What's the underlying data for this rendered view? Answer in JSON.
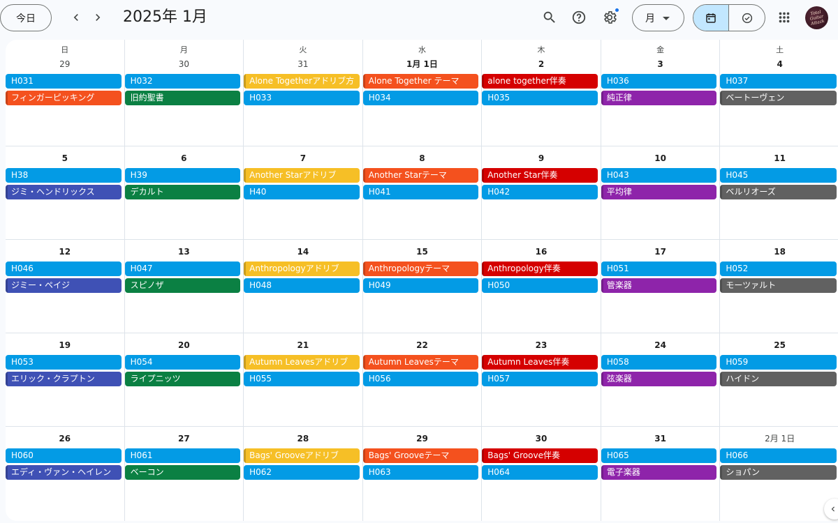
{
  "header": {
    "today_label": "今日",
    "month_title": "2025年 1月",
    "view_label": "月"
  },
  "icons": {
    "prev": "chevron-left-icon",
    "next": "chevron-right-icon",
    "search": "search-icon",
    "help": "help-icon",
    "settings": "gear-icon",
    "calendar_view": "calendar-icon",
    "tasks_view": "task-check-icon",
    "apps": "apps-grid-icon",
    "side_panel": "chevron-left-icon"
  },
  "avatar_text": "Total Guitar Attack",
  "colors": {
    "peacock": "#039be5",
    "tangerine": "#f4511e",
    "basil": "#0b8043",
    "banana": "#f6bf26",
    "tomato": "#d50000",
    "grape": "#8e24aa",
    "graphite": "#616161",
    "blueberry": "#3f51b5",
    "toggle_active": "#c2e7ff"
  },
  "weekdays": [
    "日",
    "月",
    "火",
    "水",
    "木",
    "金",
    "土"
  ],
  "weeks": [
    [
      {
        "day": "29",
        "other": true,
        "events": [
          {
            "title": "H031",
            "color": "peacock"
          },
          {
            "title": "フィンガーピッキング",
            "color": "tangerine",
            "bar": true
          }
        ]
      },
      {
        "day": "30",
        "other": true,
        "events": [
          {
            "title": "H032",
            "color": "peacock"
          },
          {
            "title": "旧約聖書",
            "color": "basil"
          }
        ]
      },
      {
        "day": "31",
        "other": true,
        "events": [
          {
            "title": "Alone Togetherアドリブ方",
            "color": "banana",
            "bar": true
          },
          {
            "title": "H033",
            "color": "peacock"
          }
        ]
      },
      {
        "day": "1月 1日",
        "events": [
          {
            "title": "Alone Together テーマ",
            "color": "tangerine",
            "bar": true
          },
          {
            "title": "H034",
            "color": "peacock"
          }
        ]
      },
      {
        "day": "2",
        "events": [
          {
            "title": "alone together伴奏",
            "color": "tomato",
            "bar": true
          },
          {
            "title": "H035",
            "color": "peacock"
          }
        ]
      },
      {
        "day": "3",
        "events": [
          {
            "title": "H036",
            "color": "peacock"
          },
          {
            "title": "純正律",
            "color": "grape",
            "bar": true
          }
        ]
      },
      {
        "day": "4",
        "events": [
          {
            "title": "H037",
            "color": "peacock"
          },
          {
            "title": "ベートーヴェン",
            "color": "graphite",
            "bar": true
          }
        ]
      }
    ],
    [
      {
        "day": "5",
        "events": [
          {
            "title": "H38",
            "color": "peacock"
          },
          {
            "title": "ジミ・ヘンドリックス",
            "color": "blueberry",
            "bar": true
          }
        ]
      },
      {
        "day": "6",
        "events": [
          {
            "title": "H39",
            "color": "peacock"
          },
          {
            "title": "デカルト",
            "color": "basil"
          }
        ]
      },
      {
        "day": "7",
        "events": [
          {
            "title": "Another Starアドリブ",
            "color": "banana",
            "bar": true
          },
          {
            "title": "H40",
            "color": "peacock"
          }
        ]
      },
      {
        "day": "8",
        "events": [
          {
            "title": "Another Starテーマ",
            "color": "tangerine",
            "bar": true
          },
          {
            "title": "H041",
            "color": "peacock"
          }
        ]
      },
      {
        "day": "9",
        "events": [
          {
            "title": "Another Star伴奏",
            "color": "tomato",
            "bar": true
          },
          {
            "title": "H042",
            "color": "peacock"
          }
        ]
      },
      {
        "day": "10",
        "events": [
          {
            "title": "H043",
            "color": "peacock"
          },
          {
            "title": "平均律",
            "color": "grape",
            "bar": true
          }
        ]
      },
      {
        "day": "11",
        "events": [
          {
            "title": "H045",
            "color": "peacock"
          },
          {
            "title": "ベルリオーズ",
            "color": "graphite",
            "bar": true
          }
        ]
      }
    ],
    [
      {
        "day": "12",
        "events": [
          {
            "title": "H046",
            "color": "peacock"
          },
          {
            "title": "ジミー・ペイジ",
            "color": "blueberry",
            "bar": true
          }
        ]
      },
      {
        "day": "13",
        "events": [
          {
            "title": "H047",
            "color": "peacock"
          },
          {
            "title": "スピノザ",
            "color": "basil"
          }
        ]
      },
      {
        "day": "14",
        "events": [
          {
            "title": "Anthropologyアドリブ",
            "color": "banana",
            "bar": true
          },
          {
            "title": "H048",
            "color": "peacock"
          }
        ]
      },
      {
        "day": "15",
        "events": [
          {
            "title": "Anthropologyテーマ",
            "color": "tangerine",
            "bar": true
          },
          {
            "title": "H049",
            "color": "peacock"
          }
        ]
      },
      {
        "day": "16",
        "events": [
          {
            "title": "Anthropology伴奏",
            "color": "tomato",
            "bar": true
          },
          {
            "title": "H050",
            "color": "peacock"
          }
        ]
      },
      {
        "day": "17",
        "events": [
          {
            "title": "H051",
            "color": "peacock"
          },
          {
            "title": "管楽器",
            "color": "grape",
            "bar": true
          }
        ]
      },
      {
        "day": "18",
        "events": [
          {
            "title": "H052",
            "color": "peacock"
          },
          {
            "title": "モーツァルト",
            "color": "graphite",
            "bar": true
          }
        ]
      }
    ],
    [
      {
        "day": "19",
        "events": [
          {
            "title": "H053",
            "color": "peacock"
          },
          {
            "title": "エリック・クラプトン",
            "color": "blueberry",
            "bar": true
          }
        ]
      },
      {
        "day": "20",
        "events": [
          {
            "title": "H054",
            "color": "peacock"
          },
          {
            "title": "ライプニッツ",
            "color": "basil"
          }
        ]
      },
      {
        "day": "21",
        "events": [
          {
            "title": "Autumn Leavesアドリブ",
            "color": "banana",
            "bar": true
          },
          {
            "title": "H055",
            "color": "peacock"
          }
        ]
      },
      {
        "day": "22",
        "events": [
          {
            "title": "Autumn Leavesテーマ",
            "color": "tangerine",
            "bar": true
          },
          {
            "title": "H056",
            "color": "peacock"
          }
        ]
      },
      {
        "day": "23",
        "events": [
          {
            "title": "Autumn Leaves伴奏",
            "color": "tomato",
            "bar": true
          },
          {
            "title": "H057",
            "color": "peacock"
          }
        ]
      },
      {
        "day": "24",
        "events": [
          {
            "title": "H058",
            "color": "peacock"
          },
          {
            "title": "弦楽器",
            "color": "grape",
            "bar": true
          }
        ]
      },
      {
        "day": "25",
        "events": [
          {
            "title": "H059",
            "color": "peacock"
          },
          {
            "title": "ハイドン",
            "color": "graphite",
            "bar": true
          }
        ]
      }
    ],
    [
      {
        "day": "26",
        "events": [
          {
            "title": "H060",
            "color": "peacock"
          },
          {
            "title": "エディ・ヴァン・ヘイレン",
            "color": "blueberry",
            "bar": true
          }
        ]
      },
      {
        "day": "27",
        "events": [
          {
            "title": "H061",
            "color": "peacock"
          },
          {
            "title": "ベーコン",
            "color": "basil"
          }
        ]
      },
      {
        "day": "28",
        "events": [
          {
            "title": "Bags' Grooveアドリブ",
            "color": "banana",
            "bar": true
          },
          {
            "title": "H062",
            "color": "peacock"
          }
        ]
      },
      {
        "day": "29",
        "events": [
          {
            "title": "Bags' Grooveテーマ",
            "color": "tangerine",
            "bar": true
          },
          {
            "title": "H063",
            "color": "peacock"
          }
        ]
      },
      {
        "day": "30",
        "events": [
          {
            "title": "Bags' Groove伴奏",
            "color": "tomato",
            "bar": true
          },
          {
            "title": "H064",
            "color": "peacock"
          }
        ]
      },
      {
        "day": "31",
        "events": [
          {
            "title": "H065",
            "color": "peacock"
          },
          {
            "title": "電子楽器",
            "color": "grape",
            "bar": true
          }
        ]
      },
      {
        "day": "2月 1日",
        "other": true,
        "events": [
          {
            "title": "H066",
            "color": "peacock"
          },
          {
            "title": "ショパン",
            "color": "graphite",
            "bar": true
          }
        ]
      }
    ]
  ]
}
